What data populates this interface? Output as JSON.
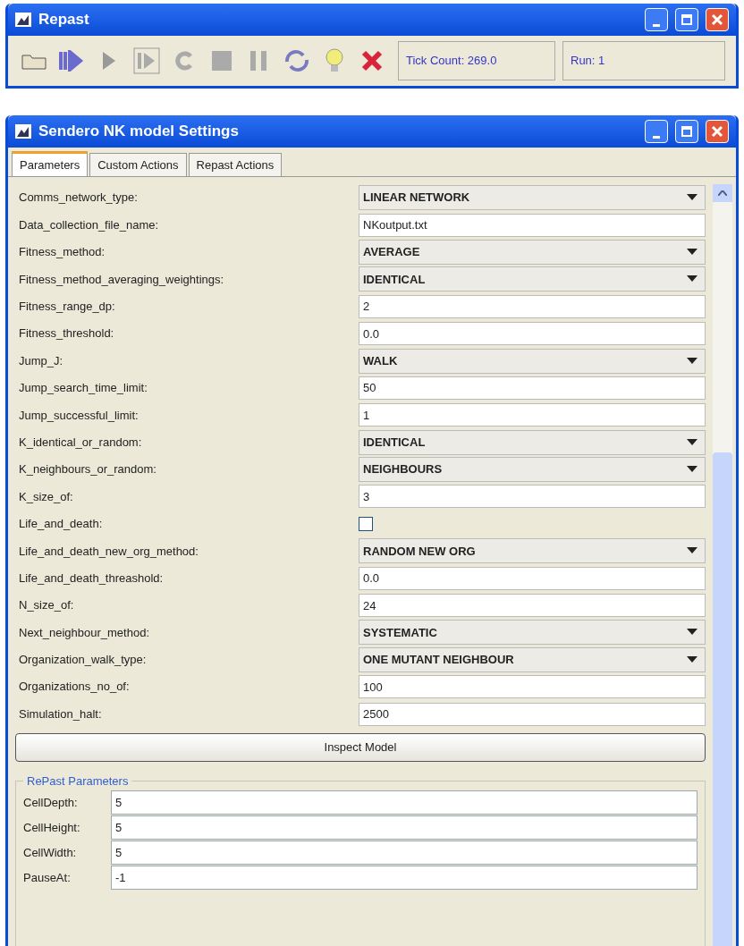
{
  "main_window": {
    "title": "Repast",
    "toolbar": {
      "tick_count": "Tick Count: 269.0",
      "run": "Run: 1"
    }
  },
  "settings_window": {
    "title": "Sendero NK model Settings",
    "tabs": [
      {
        "label": "Parameters",
        "selected": true
      },
      {
        "label": "Custom Actions",
        "selected": false
      },
      {
        "label": "Repast Actions",
        "selected": false
      }
    ],
    "parameters": [
      {
        "label": "Comms_network_type:",
        "kind": "select",
        "value": "LINEAR NETWORK"
      },
      {
        "label": "Data_collection_file_name:",
        "kind": "text",
        "value": "NKoutput.txt"
      },
      {
        "label": "Fitness_method:",
        "kind": "select",
        "value": "AVERAGE"
      },
      {
        "label": "Fitness_method_averaging_weightings:",
        "kind": "select",
        "value": "IDENTICAL"
      },
      {
        "label": "Fitness_range_dp:",
        "kind": "text",
        "value": "2"
      },
      {
        "label": "Fitness_threshold:",
        "kind": "text",
        "value": "0.0"
      },
      {
        "label": "Jump_J:",
        "kind": "select",
        "value": "WALK"
      },
      {
        "label": "Jump_search_time_limit:",
        "kind": "text",
        "value": "50"
      },
      {
        "label": "Jump_successful_limit:",
        "kind": "text",
        "value": "1"
      },
      {
        "label": "K_identical_or_random:",
        "kind": "select",
        "value": "IDENTICAL"
      },
      {
        "label": "K_neighbours_or_random:",
        "kind": "select",
        "value": "NEIGHBOURS"
      },
      {
        "label": "K_size_of:",
        "kind": "text",
        "value": "3"
      },
      {
        "label": "Life_and_death:",
        "kind": "checkbox",
        "checked": false
      },
      {
        "label": "Life_and_death_new_org_method:",
        "kind": "select",
        "value": "RANDOM NEW ORG"
      },
      {
        "label": "Life_and_death_threashold:",
        "kind": "text",
        "value": "0.0"
      },
      {
        "label": "N_size_of:",
        "kind": "text",
        "value": "24"
      },
      {
        "label": "Next_neighbour_method:",
        "kind": "select",
        "value": "SYSTEMATIC"
      },
      {
        "label": "Organization_walk_type:",
        "kind": "select",
        "value": "ONE MUTANT NEIGHBOUR"
      },
      {
        "label": "Organizations_no_of:",
        "kind": "text",
        "value": "100"
      },
      {
        "label": "Simulation_halt:",
        "kind": "text",
        "value": "2500"
      }
    ],
    "inspect_button": "Inspect Model",
    "repast_parameters": {
      "title": "RePast Parameters",
      "rows": [
        {
          "label": "CellDepth:",
          "value": "5"
        },
        {
          "label": "CellHeight:",
          "value": "5"
        },
        {
          "label": "CellWidth:",
          "value": "5"
        },
        {
          "label": "PauseAt:",
          "value": "-1"
        }
      ]
    }
  }
}
